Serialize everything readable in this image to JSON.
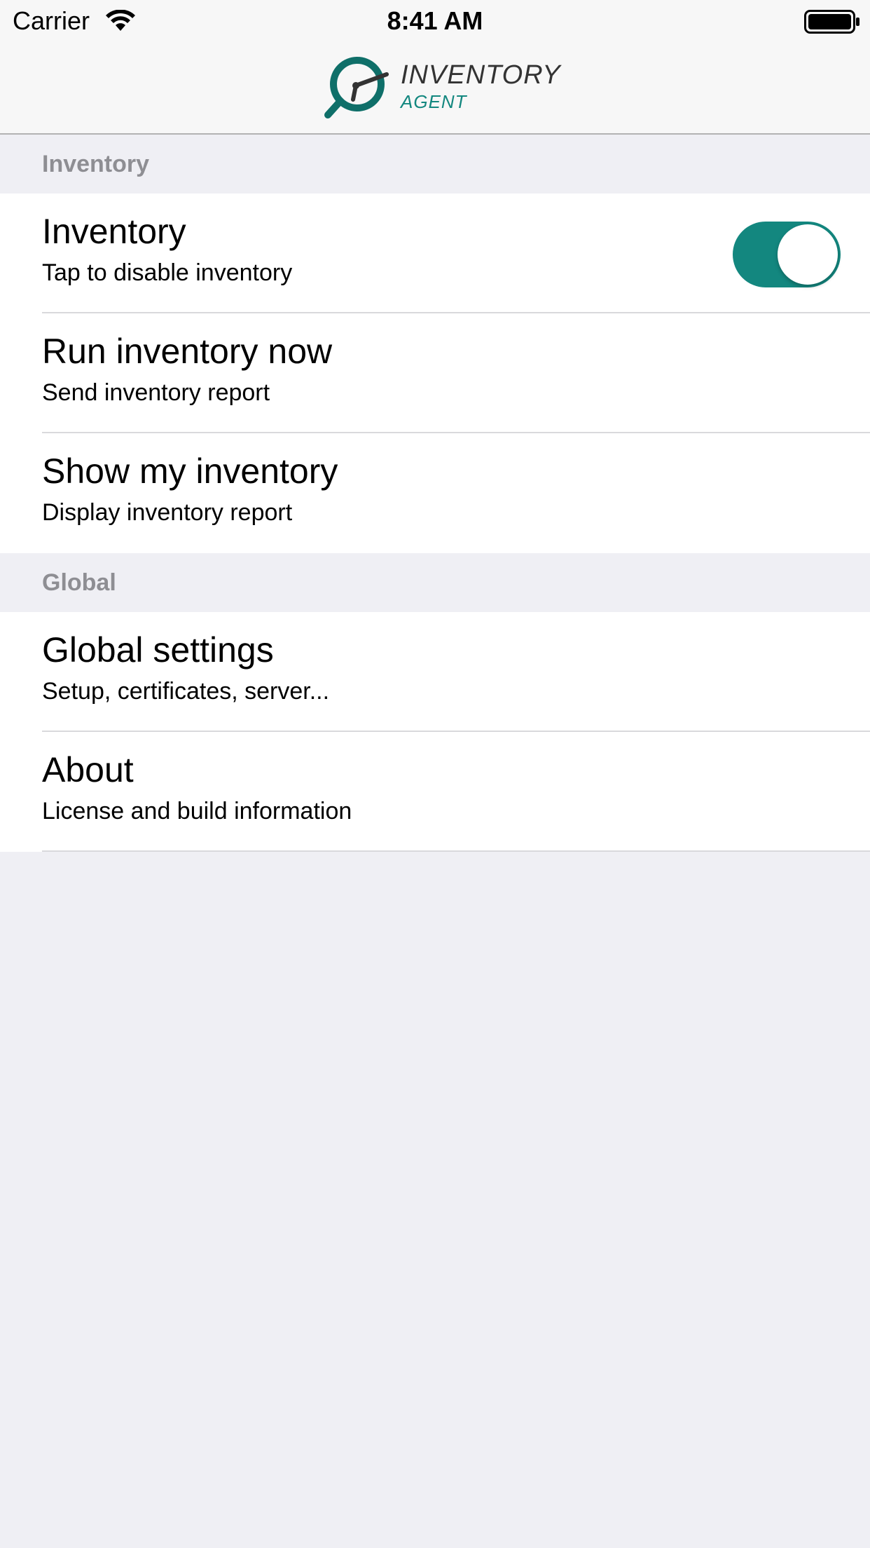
{
  "status_bar": {
    "carrier": "Carrier",
    "time": "8:41 AM"
  },
  "nav": {
    "logo_title": "INVENTORY",
    "logo_subtitle": "AGENT"
  },
  "colors": {
    "accent": "#13877f",
    "section_text": "#8e8e93",
    "background": "#efeff4"
  },
  "sections": [
    {
      "header": "Inventory",
      "rows": [
        {
          "title": "Inventory",
          "subtitle": "Tap to disable inventory",
          "toggle_on": true
        },
        {
          "title": "Run inventory now",
          "subtitle": "Send inventory report"
        },
        {
          "title": "Show my inventory",
          "subtitle": "Display inventory report"
        }
      ]
    },
    {
      "header": "Global",
      "rows": [
        {
          "title": "Global settings",
          "subtitle": "Setup, certificates, server..."
        },
        {
          "title": "About",
          "subtitle": "License and build information"
        }
      ]
    }
  ]
}
